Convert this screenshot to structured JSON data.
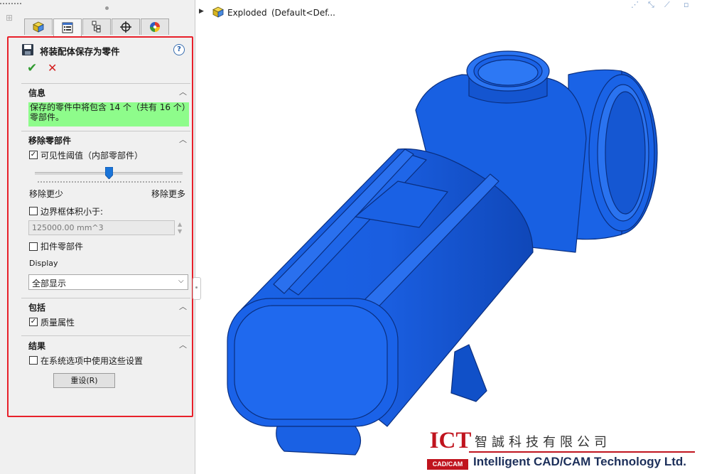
{
  "tabs": [
    {
      "name": "feature-manager",
      "icon": "cube-icon"
    },
    {
      "name": "property-manager",
      "icon": "property-list-icon"
    },
    {
      "name": "configuration-manager",
      "icon": "configuration-tree-icon"
    },
    {
      "name": "dimxpert-manager",
      "icon": "crosshair-icon"
    },
    {
      "name": "display-manager",
      "icon": "color-wheel-icon"
    }
  ],
  "panel": {
    "title": "将装配体保存为零件",
    "help": "?",
    "ok": "✔",
    "cancel": "✕"
  },
  "info": {
    "title": "信息",
    "message": "保存的零件中将包含 14 个（共有 16 个）零部件。"
  },
  "remove": {
    "title": "移除零部件",
    "visibility_threshold": {
      "label": "可见性阈值（内部零部件）",
      "checked": true
    },
    "slider": {
      "value_fraction": 0.5,
      "min_label": "移除更少",
      "max_label": "移除更多"
    },
    "bbox": {
      "label": "边界框体积小于:",
      "checked": false,
      "value": "125000.00 mm^3"
    },
    "fasteners": {
      "label": "扣件零部件",
      "checked": false
    },
    "display": {
      "label": "Display",
      "selected": "全部显示"
    }
  },
  "include": {
    "title": "包括",
    "mass_properties": {
      "label": "质量属性",
      "checked": true
    }
  },
  "result": {
    "title": "结果",
    "use_in_options": {
      "label": "在系统选项中使用这些设置",
      "checked": false
    },
    "reset_label": "重设(R)"
  },
  "graphics": {
    "tree_label": "Exploded",
    "tree_config": "(Default<Def...",
    "model_color": "#1060e8"
  },
  "watermark": {
    "logo": "ICT",
    "logo_sub": "CAD/CAM",
    "company_cn": "智誠科技有限公司",
    "company_en": "Intelligent CAD/CAM Technology Ltd."
  },
  "colors": {
    "accent_red": "#e8202a",
    "info_green": "#8efc8b",
    "logo_red": "#c0141e"
  }
}
